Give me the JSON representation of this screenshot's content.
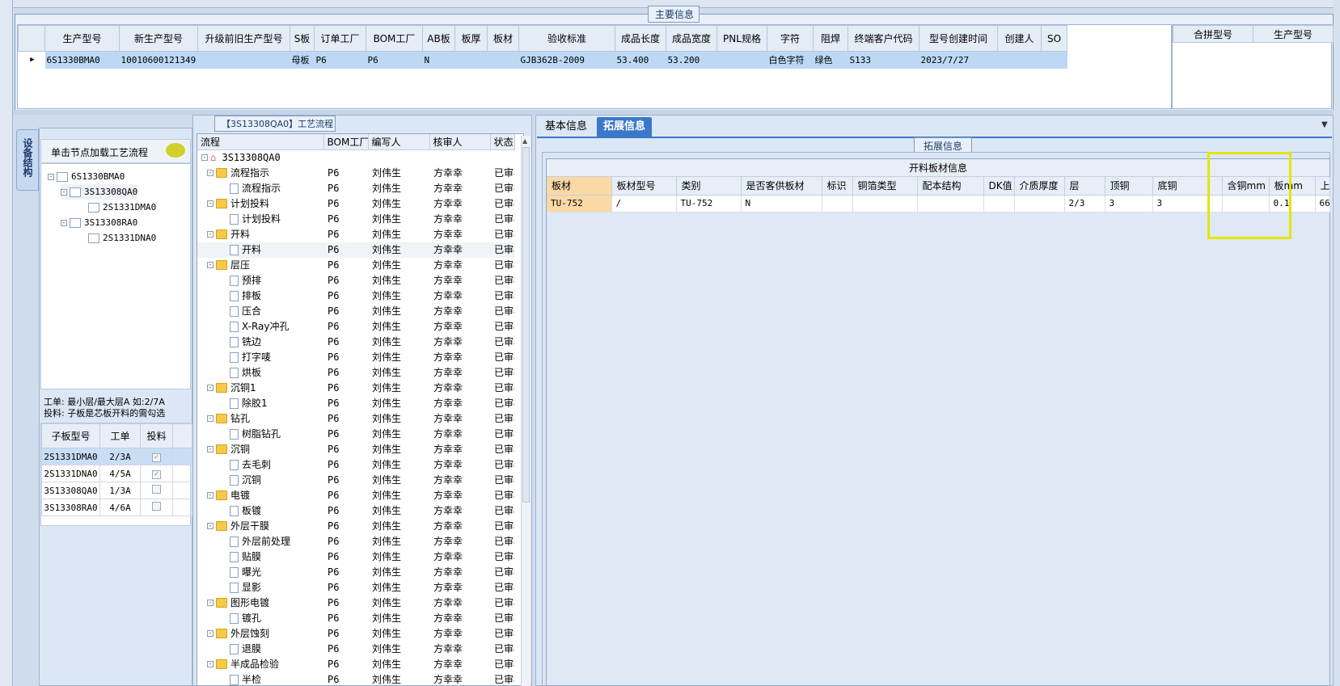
{
  "main_section": {
    "title": "主要信息",
    "columns": [
      "生产型号",
      "新生产型号",
      "升级前旧生产型号",
      "S板",
      "订单工厂",
      "BOM工厂",
      "AB板",
      "板厚",
      "板材",
      "验收标准",
      "成品长度",
      "成品宽度",
      "PNL规格",
      "字符",
      "阻焊",
      "终端客户代码",
      "型号创建时间",
      "创建人",
      "SO"
    ],
    "row": [
      "6S1330BMA0",
      "10010600121349",
      "",
      "母板",
      "P6",
      "P6",
      "N",
      "",
      "",
      "GJB362B-2009",
      "53.400",
      "53.200",
      "",
      "白色字符",
      "绿色",
      "S133",
      "2023/7/27",
      "",
      ""
    ],
    "right_columns": [
      "合拼型号",
      "生产型号"
    ]
  },
  "left_panel": {
    "side_tab": "设备结构",
    "hint": "单击节点加载工艺流程",
    "tree": [
      "6S1330BMA0",
      "3S13308QA0",
      "2S1331DMA0",
      "3S13308RA0",
      "2S1331DNA0"
    ],
    "note1": "工单: 最小层/最大层A 如:2/7A",
    "note2": "投料: 子板是芯板开料的需勾选",
    "sub_columns": [
      "子板型号",
      "工单",
      "投料"
    ],
    "sub_rows": [
      {
        "model": "2S1331DMA0",
        "order": "2/3A",
        "checked": true
      },
      {
        "model": "2S1331DNA0",
        "order": "4/5A",
        "checked": true
      },
      {
        "model": "3S13308QA0",
        "order": "1/3A",
        "checked": false
      },
      {
        "model": "3S13308RA0",
        "order": "4/6A",
        "checked": false
      }
    ]
  },
  "process": {
    "title": "【3S13308QA0】工艺流程",
    "columns": [
      "流程",
      "BOM工厂",
      "编写人",
      "核审人",
      "状态"
    ],
    "root": "3S13308QA0",
    "factory": "P6",
    "writer": "刘伟生",
    "reviewer": "方幸幸",
    "status": "已审核",
    "rows": [
      {
        "name": "流程指示",
        "folder": true
      },
      {
        "name": "流程指示",
        "folder": false
      },
      {
        "name": "计划投料",
        "folder": true
      },
      {
        "name": "计划投料",
        "folder": false
      },
      {
        "name": "开料",
        "folder": true
      },
      {
        "name": "开料",
        "folder": false
      },
      {
        "name": "层压",
        "folder": true
      },
      {
        "name": "预排",
        "folder": false
      },
      {
        "name": "排板",
        "folder": false
      },
      {
        "name": "压合",
        "folder": false
      },
      {
        "name": "X-Ray冲孔",
        "folder": false
      },
      {
        "name": "铣边",
        "folder": false
      },
      {
        "name": "打字唛",
        "folder": false
      },
      {
        "name": "烘板",
        "folder": false
      },
      {
        "name": "沉铜1",
        "folder": true
      },
      {
        "name": "除胶1",
        "folder": false
      },
      {
        "name": "钻孔",
        "folder": true
      },
      {
        "name": "树脂钻孔",
        "folder": false
      },
      {
        "name": "沉铜",
        "folder": true
      },
      {
        "name": "去毛刺",
        "folder": false
      },
      {
        "name": "沉铜",
        "folder": false
      },
      {
        "name": "电镀",
        "folder": true
      },
      {
        "name": "板镀",
        "folder": false
      },
      {
        "name": "外层干膜",
        "folder": true
      },
      {
        "name": "外层前处理",
        "folder": false
      },
      {
        "name": "贴膜",
        "folder": false
      },
      {
        "name": "曝光",
        "folder": false
      },
      {
        "name": "显影",
        "folder": false
      },
      {
        "name": "图形电镀",
        "folder": true
      },
      {
        "name": "镀孔",
        "folder": false
      },
      {
        "name": "外层蚀刻",
        "folder": true
      },
      {
        "name": "退膜",
        "folder": false
      },
      {
        "name": "半成品检验",
        "folder": true
      },
      {
        "name": "半检",
        "folder": false
      }
    ]
  },
  "right_panel": {
    "tabs": [
      "基本信息",
      "拓展信息"
    ],
    "active_tab": "拓展信息",
    "group_title": "拓展信息",
    "grid_title": "开料板材信息",
    "columns": [
      "板材",
      "板材型号",
      "类别",
      "是否客供板材",
      "标识",
      "铜箔类型",
      "配本结构",
      "DK值",
      "介质厚度",
      "层",
      "顶铜",
      "底铜",
      "含铜mm",
      "板mm",
      "上"
    ],
    "row": [
      "TU-752",
      "/",
      "TU-752",
      "N",
      "",
      "",
      "",
      "",
      "",
      "2/3",
      "3",
      "3",
      "",
      "0.1",
      "66"
    ]
  }
}
